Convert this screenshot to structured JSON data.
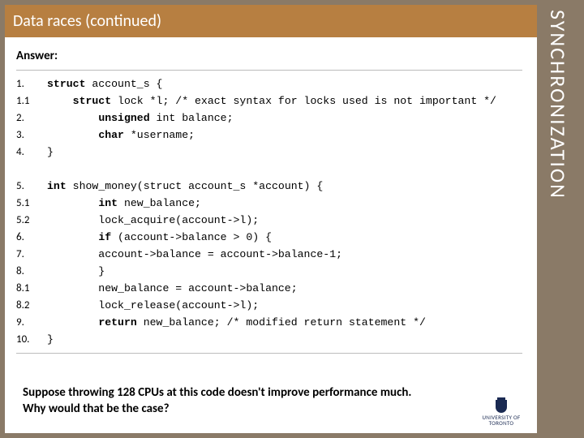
{
  "title": "Data races (continued)",
  "side_label": "SYNCHRONIZATION",
  "answer_label": "Answer:",
  "code": [
    {
      "n": "1.",
      "indent": 0,
      "kw": "struct",
      "rest": " account_s {"
    },
    {
      "n": "1.1",
      "indent": 1,
      "kw": "struct",
      "rest": " lock *l; /* exact syntax for locks used is not important */"
    },
    {
      "n": "2.",
      "indent": 2,
      "kw": "unsigned",
      "rest": " int balance;"
    },
    {
      "n": "3.",
      "indent": 2,
      "kw": "char",
      "rest": " *username;"
    },
    {
      "n": "4.",
      "indent": 0,
      "kw": "",
      "rest": "}"
    },
    {
      "blank": true
    },
    {
      "n": "5.",
      "indent": 0,
      "kw": "int",
      "rest": " show_money(struct account_s *account) {"
    },
    {
      "n": "5.1",
      "indent": 2,
      "kw": "int",
      "rest": " new_balance;"
    },
    {
      "n": "5.2",
      "indent": 2,
      "kw": "",
      "rest": "lock_acquire(account->l);"
    },
    {
      "n": "6.",
      "indent": 2,
      "kw": "if",
      "rest": " (account->balance > 0) {"
    },
    {
      "n": "7.",
      "indent": 4,
      "kw": "",
      "rest": "account->balance = account->balance-1;"
    },
    {
      "n": "8.",
      "indent": 2,
      "kw": "",
      "rest": "}"
    },
    {
      "n": "8.1",
      "indent": 2,
      "kw": "",
      "rest": "new_balance = account->balance;"
    },
    {
      "n": "8.2",
      "indent": 2,
      "kw": "",
      "rest": "lock_release(account->l);"
    },
    {
      "n": "9.",
      "indent": 2,
      "kw": "return",
      "rest": " new_balance; /* modified return statement */"
    },
    {
      "n": "10.",
      "indent": 0,
      "kw": "",
      "rest": "}"
    }
  ],
  "question_line1": "Suppose throwing 128 CPUs at this code doesn't improve performance much.",
  "question_line2": "Why would that be the case?",
  "logo_text": "UNIVERSITY OF\nTORONTO"
}
